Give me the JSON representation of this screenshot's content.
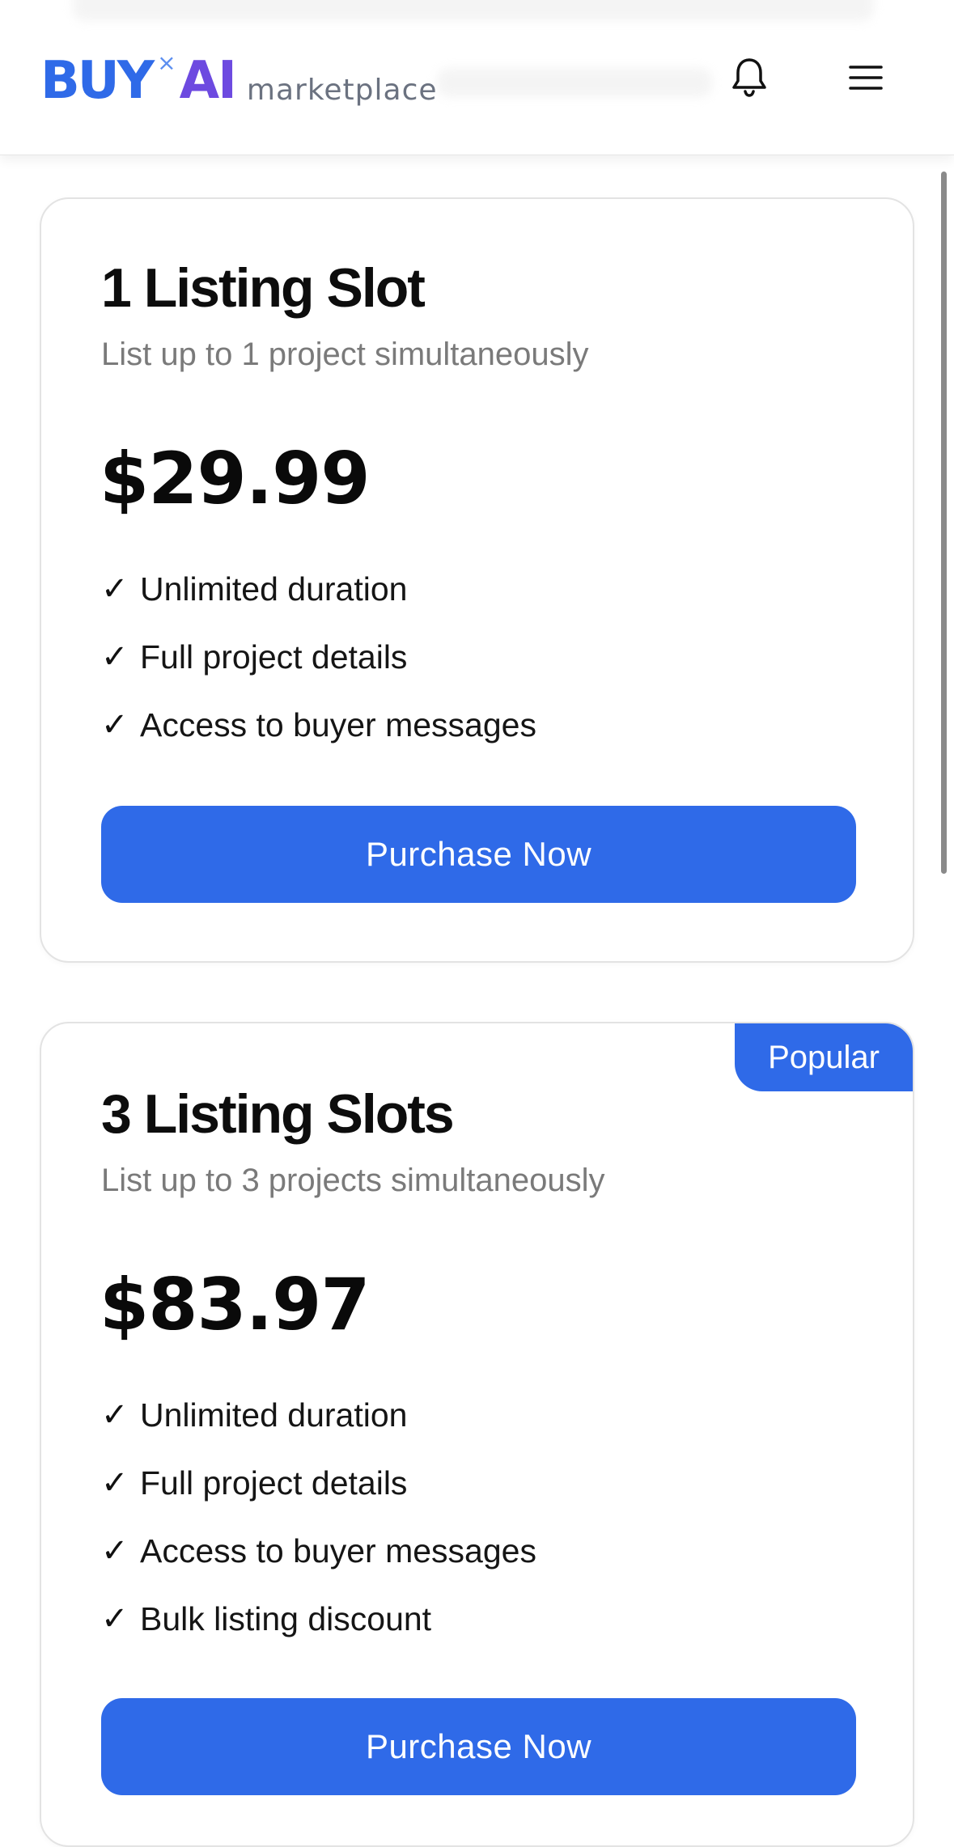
{
  "header": {
    "logo": {
      "buy": "BUY",
      "separator": "×",
      "ai": "AI",
      "tagline": "marketplace"
    },
    "icons": {
      "notifications": "bell-icon",
      "menu": "hamburger-menu-icon"
    }
  },
  "plans": [
    {
      "title": "1 Listing Slot",
      "subtitle": "List up to 1 project simultaneously",
      "price": "$29.99",
      "features": [
        "Unlimited duration",
        "Full project details",
        "Access to buyer messages"
      ],
      "button_label": "Purchase Now",
      "badge": ""
    },
    {
      "title": "3 Listing Slots",
      "subtitle": "List up to 3 projects simultaneously",
      "price": "$83.97",
      "features": [
        "Unlimited duration",
        "Full project details",
        "Access to buyer messages",
        "Bulk listing discount"
      ],
      "button_label": "Purchase Now",
      "badge": "Popular"
    }
  ],
  "check_glyph": "✓",
  "colors": {
    "accent": "#2f6ae8",
    "logo_ai": "#6d4ae0",
    "muted_text": "#7a7a7a"
  }
}
